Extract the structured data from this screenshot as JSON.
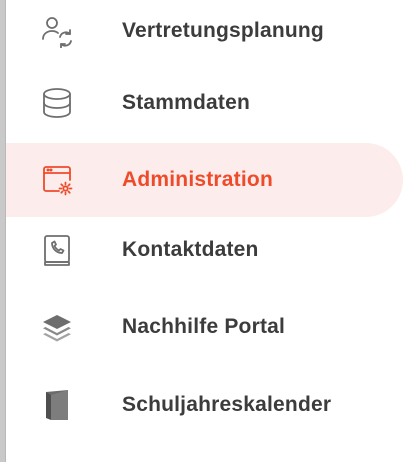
{
  "sidebar": {
    "accent_color": "#ee4b2b",
    "active_background": "#fdecec",
    "items": [
      {
        "label": "Vertretungsplanung",
        "icon": "user-swap-icon",
        "active": false
      },
      {
        "label": "Stammdaten",
        "icon": "database-icon",
        "active": false
      },
      {
        "label": "Administration",
        "icon": "settings-window-icon",
        "active": true
      },
      {
        "label": "Kontaktdaten",
        "icon": "phone-contact-icon",
        "active": false
      },
      {
        "label": "Nachhilfe Portal",
        "icon": "layers-icon",
        "active": false
      },
      {
        "label": "Schuljahreskalender",
        "icon": "calendar-book-icon",
        "active": false
      }
    ]
  }
}
